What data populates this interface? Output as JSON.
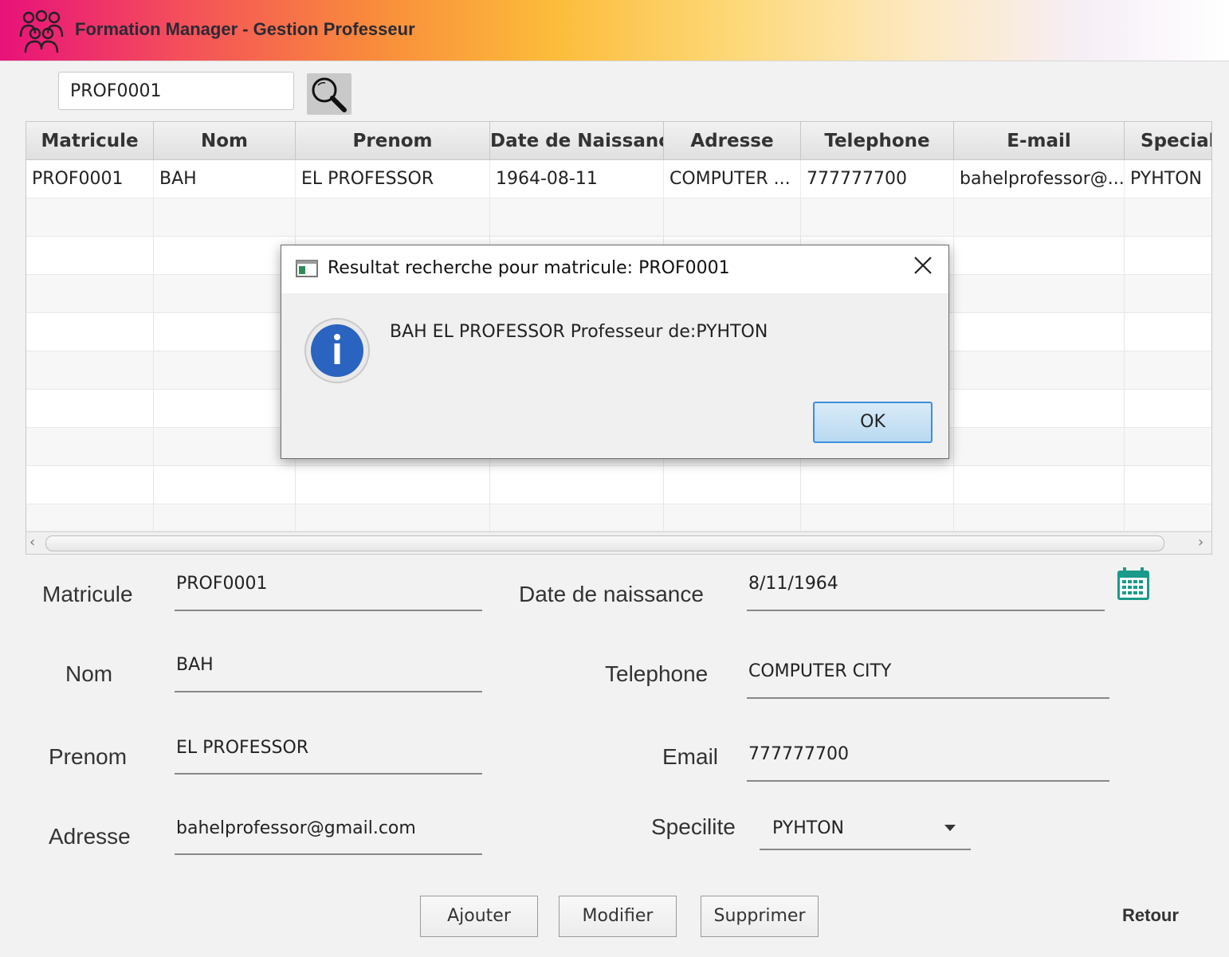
{
  "window": {
    "title": "Formation Manager - Gestion Professeur"
  },
  "search": {
    "value": "PROF0001"
  },
  "table": {
    "columns": [
      "Matricule",
      "Nom",
      "Prenom",
      "Date de Naissance",
      "Adresse",
      "Telephone",
      "E-mail",
      "Speciali"
    ],
    "rows": [
      [
        "PROF0001",
        "BAH",
        "EL PROFESSOR",
        "1964-08-11",
        "COMPUTER ...",
        "777777700",
        "bahelprofessor@...",
        "PYHTON"
      ]
    ]
  },
  "form": {
    "matricule": {
      "label": "Matricule",
      "value": "PROF0001"
    },
    "nom": {
      "label": "Nom",
      "value": "BAH"
    },
    "prenom": {
      "label": "Prenom",
      "value": "EL PROFESSOR"
    },
    "adresse": {
      "label": "Adresse",
      "value": "bahelprofessor@gmail.com"
    },
    "date_naissance": {
      "label": "Date de naissance",
      "value": "8/11/1964"
    },
    "telephone": {
      "label": "Telephone",
      "value": "COMPUTER CITY"
    },
    "email": {
      "label": "Email",
      "value": "777777700"
    },
    "specialite": {
      "label": "Specilite",
      "value": "PYHTON"
    }
  },
  "buttons": {
    "ajouter": "Ajouter",
    "modifier": "Modifier",
    "supprimer": "Supprimer",
    "retour": "Retour"
  },
  "dialog": {
    "title": "Resultat recherche pour matricule: PROF0001",
    "message": "BAH EL PROFESSOR Professeur de:PYHTON",
    "ok": "OK"
  },
  "colors": {
    "accent_blue": "#2a64c0",
    "ok_border": "#3d8ee0",
    "calendar_green": "#1a9a8a"
  },
  "icons": {
    "app": "people-group-icon",
    "search": "magnifier-icon",
    "calendar": "calendar-icon",
    "info": "info-icon",
    "close": "close-icon",
    "dropdown": "chevron-down-icon"
  }
}
